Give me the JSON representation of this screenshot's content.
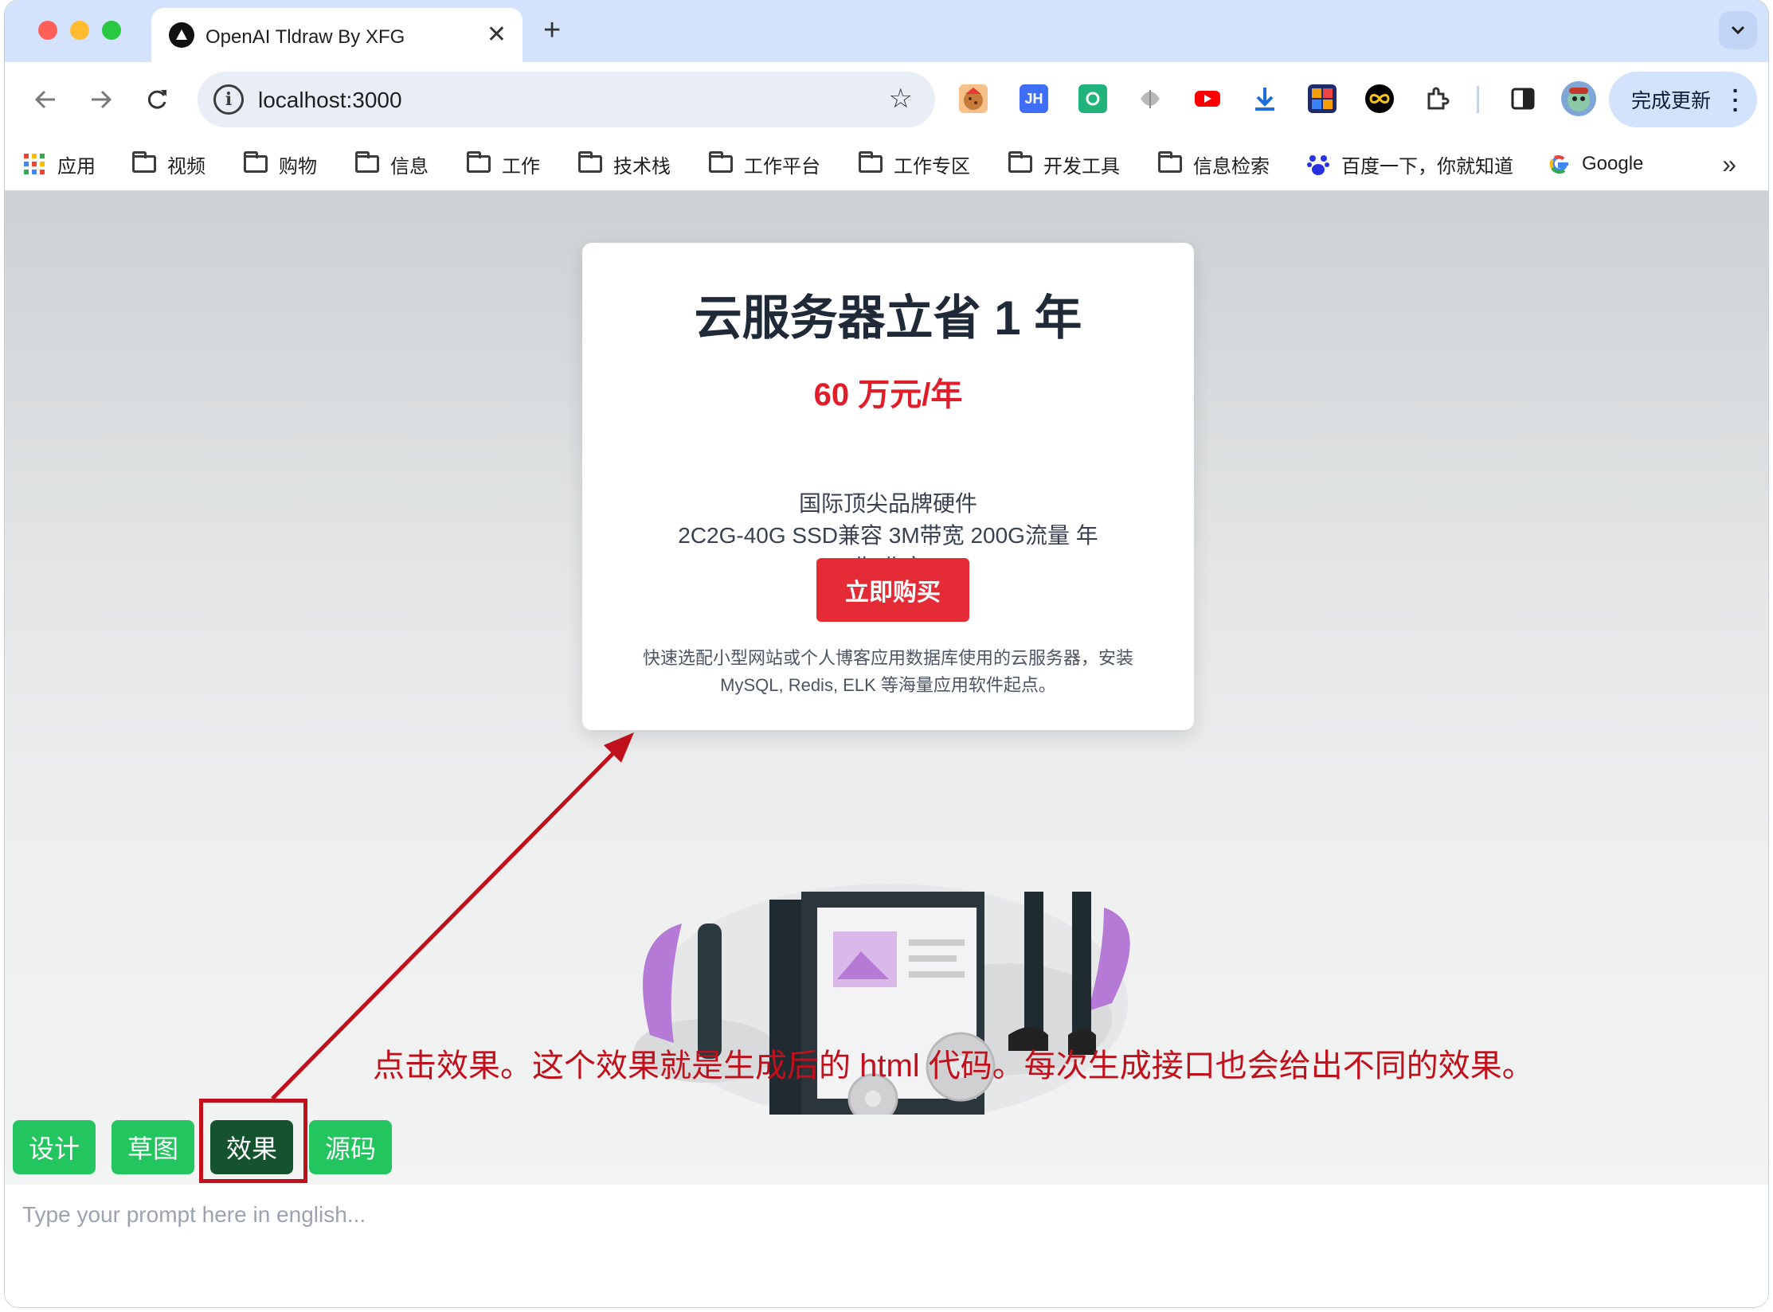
{
  "browser": {
    "tab_title": "OpenAI Tldraw By XFG",
    "tab_close": "✕",
    "new_tab": "+",
    "url": "localhost:3000",
    "update_label": "完成更新",
    "bookmarks_more": "»",
    "bookmarks": [
      {
        "label": "应用",
        "icon": "apps-grid-icon"
      },
      {
        "label": "视频",
        "icon": "folder-icon"
      },
      {
        "label": "购物",
        "icon": "folder-icon"
      },
      {
        "label": "信息",
        "icon": "folder-icon"
      },
      {
        "label": "工作",
        "icon": "folder-icon"
      },
      {
        "label": "技术栈",
        "icon": "folder-icon"
      },
      {
        "label": "工作平台",
        "icon": "folder-icon"
      },
      {
        "label": "工作专区",
        "icon": "folder-icon"
      },
      {
        "label": "开发工具",
        "icon": "folder-icon"
      },
      {
        "label": "信息检索",
        "icon": "folder-icon"
      },
      {
        "label": "百度一下，你就知道",
        "icon": "baidu-icon"
      },
      {
        "label": "Google",
        "icon": "google-icon"
      }
    ],
    "extensions": [
      "cookie-icon",
      "jh-icon",
      "refresh-ext-icon",
      "shell-icon",
      "youtube-icon",
      "download-icon",
      "puzzle-color-icon",
      "infinity-icon",
      "extensions-icon"
    ],
    "ext_jh_label": "JH"
  },
  "card": {
    "title": "云服务器立省 1 年",
    "price": "60 万元/年",
    "features": [
      "国际顶尖品牌硬件",
      "2C2G-40G SSD兼容 3M带宽 200G流量 年",
      "北-北京"
    ],
    "buy_label": "立即购买",
    "description_line1": "快速选配小型网站或个人博客应用数据库使用的云服务器，安装",
    "description_line2": "MySQL, Redis, ELK 等海量应用软件起点。"
  },
  "annotation": "点击效果。这个效果就是生成后的 html 代码。每次生成接口也会给出不同的效果。",
  "mode_buttons": [
    {
      "label": "设计",
      "active": false
    },
    {
      "label": "草图",
      "active": false
    },
    {
      "label": "效果",
      "active": true
    },
    {
      "label": "源码",
      "active": false
    }
  ],
  "prompt": {
    "value": "",
    "placeholder": "Type your prompt here in english..."
  },
  "colors": {
    "accent_green": "#22c55e",
    "active_green": "#14532d",
    "price_red": "#e11d2a",
    "buy_red": "#e52b36",
    "annotation_red": "#c0101b"
  }
}
